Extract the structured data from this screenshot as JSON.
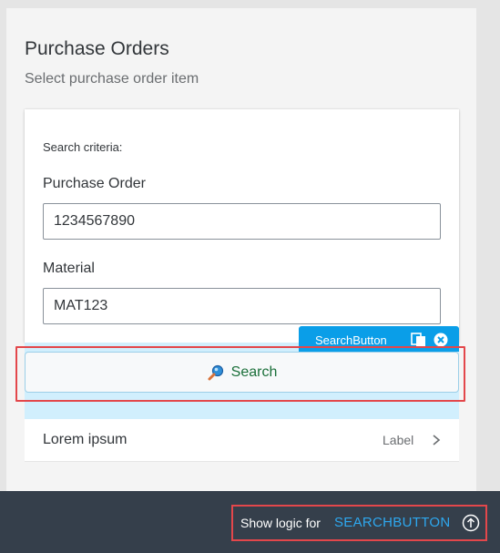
{
  "page": {
    "title": "Purchase Orders",
    "subtitle": "Select purchase order item"
  },
  "search_card": {
    "criteria_label": "Search criteria:",
    "purchase_order": {
      "label": "Purchase Order",
      "value": "1234567890",
      "placeholder": ""
    },
    "material": {
      "label": "Material",
      "value": "MAT123",
      "placeholder": ""
    }
  },
  "selection_tag": {
    "label": "SearchButton",
    "icons": [
      "copy-icon",
      "close-icon"
    ]
  },
  "search_button": {
    "label": "Search",
    "icon": "search-icon"
  },
  "list_item": {
    "title": "Lorem ipsum",
    "label": "Label",
    "icon": "chevron-right-icon"
  },
  "footer": {
    "show_logic_text": "Show logic for",
    "target": "SEARCHBUTTON",
    "icon": "arrow-up-circle-icon"
  },
  "colors": {
    "accent": "#0a9ee8",
    "highlight": "#e3474b",
    "footer_bg": "#353f4b",
    "selection_bg": "#d1effd"
  }
}
